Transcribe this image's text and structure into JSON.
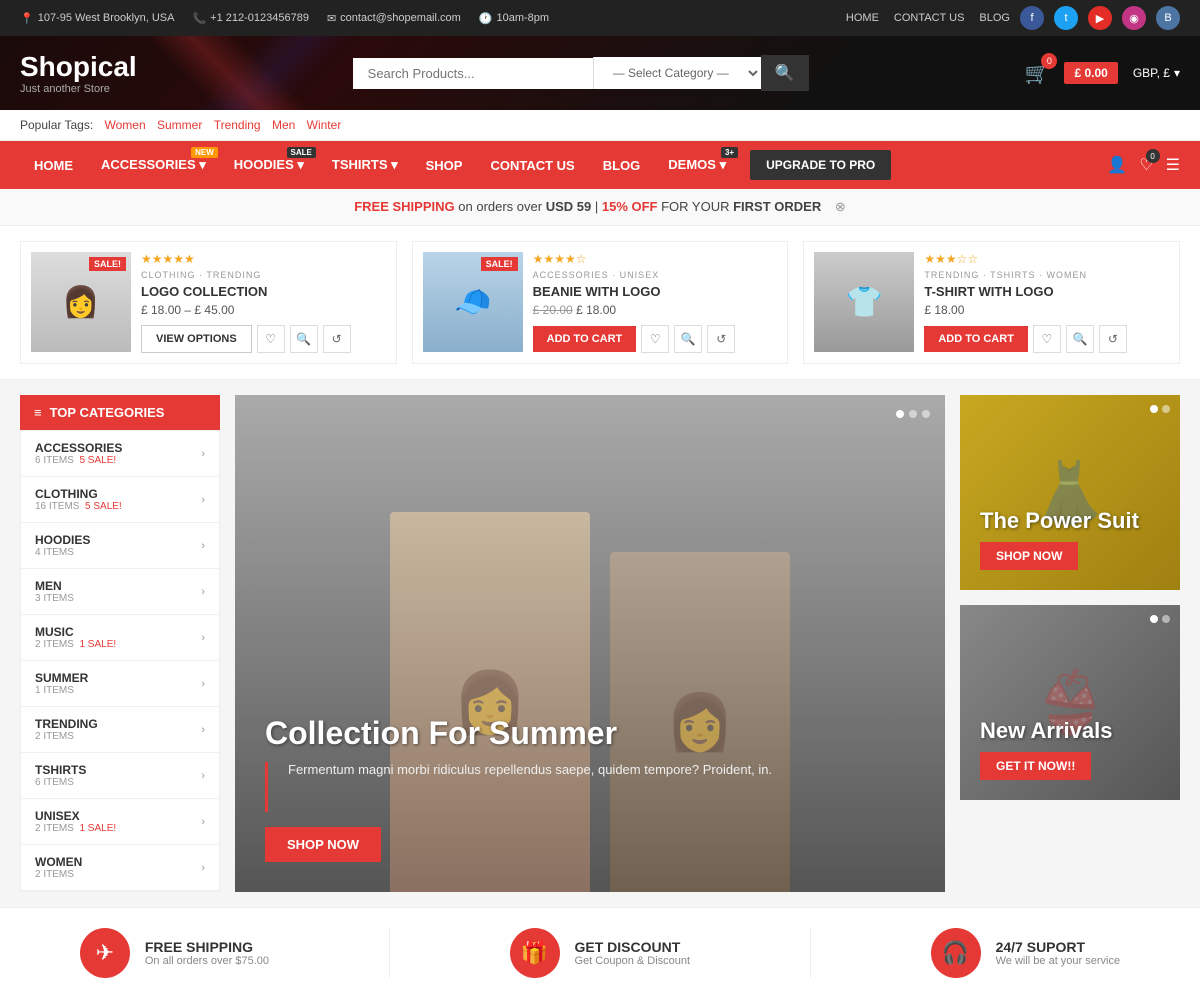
{
  "topbar": {
    "address": "107-95 West Brooklyn, USA",
    "phone": "+1 212-0123456789",
    "email": "contact@shopemail.com",
    "hours": "10am-8pm",
    "nav_links": [
      "HOME",
      "CONTACT US",
      "BLOG"
    ],
    "socials": [
      {
        "name": "facebook",
        "symbol": "f"
      },
      {
        "name": "twitter",
        "symbol": "t"
      },
      {
        "name": "youtube",
        "symbol": "▶"
      },
      {
        "name": "instagram",
        "symbol": "◉"
      },
      {
        "name": "vk",
        "symbol": "B"
      }
    ]
  },
  "header": {
    "logo": "Shopical",
    "tagline": "Just another Store",
    "search_placeholder": "Search Products...",
    "select_category": "— Select Category —",
    "cart_count": "0",
    "cart_total": "£ 0.00",
    "currency": "GBP, £"
  },
  "popular_tags": {
    "label": "Popular Tags:",
    "tags": [
      "Women",
      "Summer",
      "Trending",
      "Men",
      "Winter"
    ]
  },
  "nav": {
    "items": [
      {
        "label": "HOME",
        "badge": null
      },
      {
        "label": "ACCESSORIES",
        "badge": "NEW",
        "badge_type": "new"
      },
      {
        "label": "HOODIES",
        "badge": "SALE",
        "badge_type": "sale"
      },
      {
        "label": "TSHIRTS",
        "badge": null
      },
      {
        "label": "SHOP",
        "badge": null
      },
      {
        "label": "CONTACT US",
        "badge": null
      },
      {
        "label": "BLOG",
        "badge": null
      },
      {
        "label": "DEMOS",
        "badge": "3+",
        "badge_type": "num"
      }
    ],
    "upgrade_label": "UPGRADE TO PRO",
    "wishlist_count": "0"
  },
  "promo": {
    "free_ship_label": "FREE SHIPPING",
    "free_ship_detail": "on orders over",
    "free_ship_amount": "USD 59",
    "divider": "|",
    "discount_label": "15% OFF",
    "discount_detail": "FOR YOUR",
    "first_order": "FIRST ORDER"
  },
  "products": [
    {
      "categories": "CLOTHING · TRENDING",
      "title": "LOGO COLLECTION",
      "price_from": "£ 18.00",
      "price_to": "£ 45.00",
      "stars": "★★★★★",
      "badge": "SALE!",
      "action": "VIEW OPTIONS"
    },
    {
      "categories": "ACCESSORIES · UNISEX",
      "title": "BEANIE WITH LOGO",
      "price_orig": "£ 20.00",
      "price": "£ 18.00",
      "stars": "★★★★☆",
      "badge": "SALE!",
      "action": "ADD TO CART"
    },
    {
      "categories": "TRENDING · TSHIRTS · WOMEN",
      "title": "T-SHIRT WITH LOGO",
      "price": "£ 18.00",
      "stars": "★★★☆☆",
      "badge": null,
      "action": "ADD TO CART"
    }
  ],
  "sidebar": {
    "title": "TOP CATEGORIES",
    "items": [
      {
        "name": "ACCESSORIES",
        "items": "6 ITEMS",
        "sale": "5 SALE!"
      },
      {
        "name": "CLOTHING",
        "items": "16 ITEMS",
        "sale": "5 SALE!"
      },
      {
        "name": "HOODIES",
        "items": "4 ITEMS",
        "sale": null
      },
      {
        "name": "MEN",
        "items": "3 ITEMS",
        "sale": null
      },
      {
        "name": "MUSIC",
        "items": "2 ITEMS",
        "sale": "1 SALE!"
      },
      {
        "name": "SUMMER",
        "items": "1 ITEMS",
        "sale": null
      },
      {
        "name": "TRENDING",
        "items": "2 ITEMS",
        "sale": null
      },
      {
        "name": "TSHIRTS",
        "items": "6 ITEMS",
        "sale": null
      },
      {
        "name": "UNISEX",
        "items": "2 ITEMS",
        "sale": "1 SALE!"
      },
      {
        "name": "WOMEN",
        "items": "2 ITEMS",
        "sale": null
      }
    ]
  },
  "main_banner": {
    "title": "Collection For Summer",
    "description": "Fermentum magni morbi ridiculus repellendus saepe, quidem tempore? Proident, in.",
    "cta": "SHOP NOW",
    "dots": 3
  },
  "side_banners": [
    {
      "title": "The Power Suit",
      "cta": "SHOP NOW",
      "dots": 2,
      "bg_class": "power-suit-bg"
    },
    {
      "title": "New Arrivals",
      "cta": "GET IT NOW!!",
      "dots": 2,
      "bg_class": "new-arrivals-bg"
    }
  ],
  "features": [
    {
      "icon": "✈",
      "title": "FREE SHIPPING",
      "subtitle": "On all orders over $75.00"
    },
    {
      "icon": "🎁",
      "title": "GET DISCOUNT",
      "subtitle": "Get Coupon & Discount"
    },
    {
      "icon": "🎧",
      "title": "24/7 SUPORT",
      "subtitle": "We will be at your service"
    }
  ]
}
